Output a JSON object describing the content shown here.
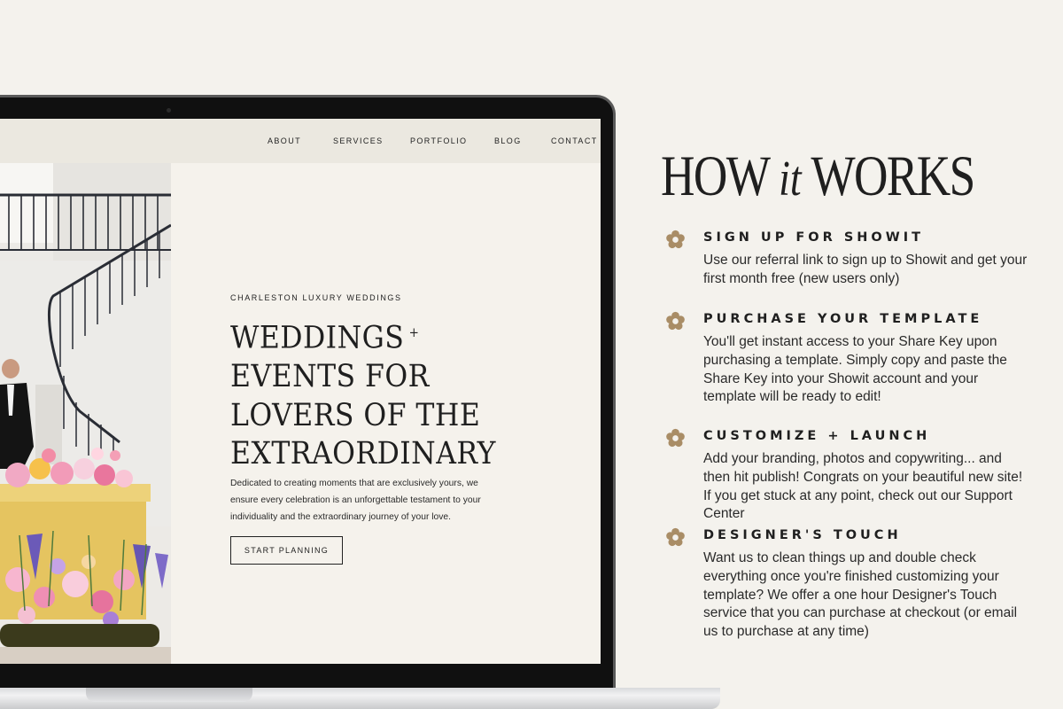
{
  "site": {
    "nav": [
      "ABOUT",
      "SERVICES",
      "PORTFOLIO",
      "BLOG",
      "CONTACT"
    ],
    "eyebrow": "CHARLESTON LUXURY WEDDINGS",
    "heading_line1": "WEDDINGS",
    "heading_plus": "+",
    "heading_rest": [
      "EVENTS FOR",
      "LOVERS OF THE",
      "EXTRAORDINARY"
    ],
    "body": "Dedicated to creating moments that are exclusively yours, we ensure every celebration is an unforgettable testament to your individuality and the extraordinary journey of your love.",
    "cta_label": "START PLANNING"
  },
  "how": {
    "title_a": "HOW",
    "title_it": "it",
    "title_b": "WORKS",
    "accent_color": "#a98d66",
    "steps": [
      {
        "icon": "flower-icon",
        "title": "SIGN UP FOR SHOWIT",
        "desc": "Use our referral link to sign up to Showit and get your first month free (new users only)"
      },
      {
        "icon": "flower-icon",
        "title": "PURCHASE YOUR TEMPLATE",
        "desc": "You'll get instant access to your Share Key upon purchasing a template. Simply copy and paste the Share Key into your Showit account and your template will be ready to edit!"
      },
      {
        "icon": "flower-icon",
        "title": "CUSTOMIZE + LAUNCH",
        "desc": "Add your branding, photos and copywriting... and then hit publish! Congrats on your beautiful new site! If you get stuck at any point, check out our Support Center"
      },
      {
        "icon": "flower-icon",
        "title": "DESIGNER'S TOUCH",
        "desc": "Want us to clean things up and double check everything once you're finished customizing your template? We offer a one hour Designer's Touch service that you can purchase at checkout (or email us to purchase at any time)"
      }
    ]
  }
}
